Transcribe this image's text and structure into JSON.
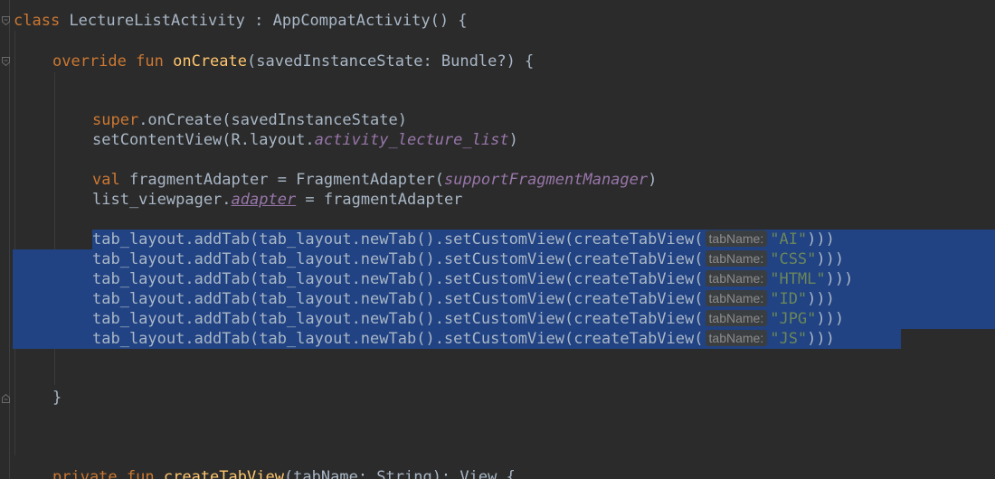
{
  "editor": {
    "line_class": {
      "kw": "class",
      "name": "LectureListActivity",
      "rest": " : AppCompatActivity() {"
    },
    "line_override": {
      "kw1": "override",
      "kw2": "fun",
      "name": "onCreate",
      "rest": "(savedInstanceState: Bundle?) {"
    },
    "line_super": {
      "kw": "super",
      "rest": ".onCreate(savedInstanceState)"
    },
    "line_setcontent": {
      "pre": "setContentView(R.layout.",
      "ref": "activity_lecture_list",
      "post": ")"
    },
    "line_val": {
      "kw": "val",
      "pre": " fragmentAdapter = FragmentAdapter(",
      "ref": "supportFragmentManager",
      "post": ")"
    },
    "line_adapter": {
      "pre": "list_viewpager.",
      "ref": "adapter",
      "post": " = fragmentAdapter"
    },
    "tab_calls": {
      "prefix": "tab_layout.addTab(tab_layout.newTab().setCustomView(createTabView(",
      "hint": "tabName:",
      "suffix": ")))",
      "values": [
        "\"AI\"",
        "\"CSS\"",
        "\"HTML\"",
        "\"ID\"",
        "\"JPG\"",
        "\"JS\""
      ]
    },
    "line_close": "}",
    "line_private": {
      "kw1": "private",
      "kw2": "fun",
      "name": "createTabView",
      "rest": "(tabName: String): View {"
    }
  },
  "colors": {
    "background": "#2b2b2b",
    "keyword": "#cc7832",
    "function": "#ffc66d",
    "identifier": "#a9b7c6",
    "property": "#9876aa",
    "string": "#6a8759",
    "selection": "#214283"
  }
}
